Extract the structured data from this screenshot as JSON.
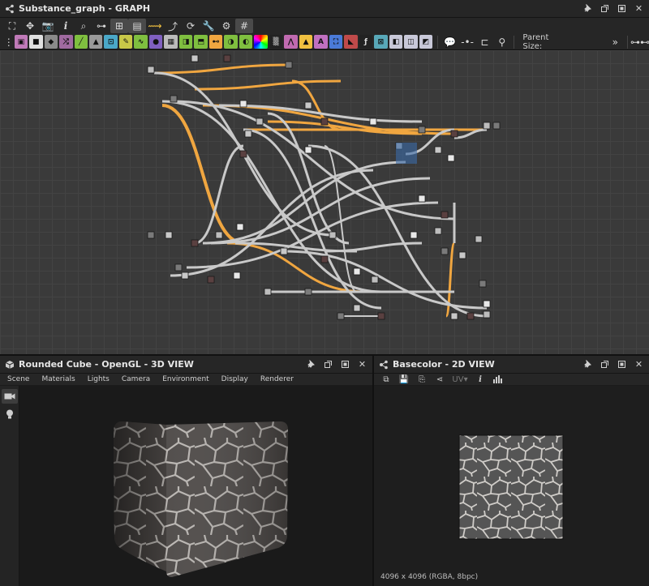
{
  "graph": {
    "title": "Substance_graph - GRAPH",
    "parent_size_label": "Parent Size:",
    "overflow_label": "»"
  },
  "view3d": {
    "title": "Rounded Cube - OpenGL - 3D VIEW",
    "menu": [
      "Scene",
      "Materials",
      "Lights",
      "Camera",
      "Environment",
      "Display",
      "Renderer"
    ]
  },
  "view2d": {
    "title": "Basecolor - 2D VIEW",
    "uv_label": "UV",
    "image_info": "4096 x 4096 (RGBA, 8bpc)"
  },
  "colors": {
    "accent_orange": "#f0a640",
    "node_link": "#c9c9c9",
    "panel_bg": "#262626",
    "graph_bg": "#3a3a3a"
  }
}
